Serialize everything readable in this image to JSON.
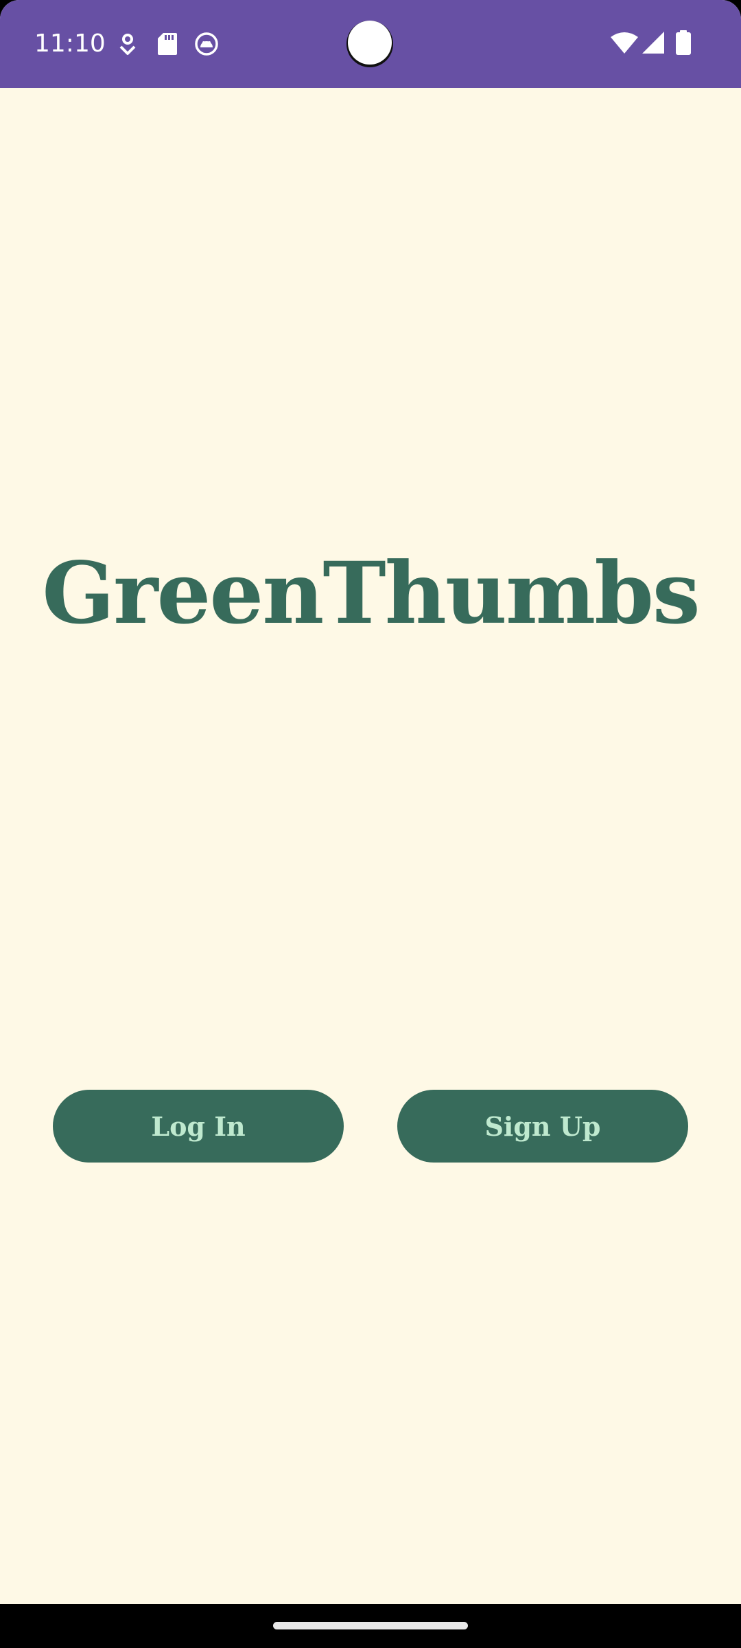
{
  "status_bar": {
    "time": "11:10",
    "background_color": "#6750a4",
    "left_icons": [
      "location-pin-icon",
      "sd-card-icon",
      "android-face-icon"
    ],
    "right_icons": [
      "wifi-icon",
      "cell-signal-icon",
      "battery-icon"
    ]
  },
  "app": {
    "title": "GreenThumbs",
    "background_color": "#fef9e6",
    "accent_color": "#376b5b",
    "button_text_color": "#bfe9cf"
  },
  "buttons": {
    "login_label": "Log In",
    "signup_label": "Sign Up"
  },
  "nav_bar": {
    "handle": "home-gesture-handle"
  }
}
